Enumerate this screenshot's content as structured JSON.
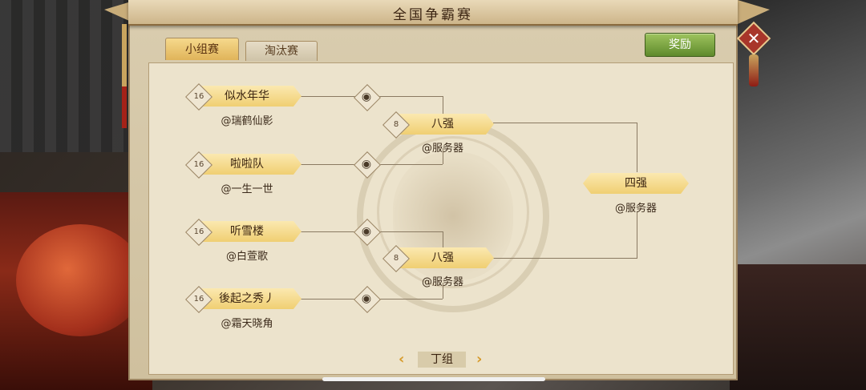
{
  "title": "全国争霸赛",
  "tabs": [
    {
      "label": "小组赛",
      "active": true
    },
    {
      "label": "淘汰赛",
      "active": false
    }
  ],
  "reward_button": "奖励",
  "close_icon": "close-icon",
  "round16": [
    {
      "seed": "16",
      "team": "似水年华",
      "server": "@瑞鹤仙影"
    },
    {
      "seed": "16",
      "team": "啦啦队",
      "server": "@一生一世"
    },
    {
      "seed": "16",
      "team": "听雪楼",
      "server": "@白萱歌"
    },
    {
      "seed": "16",
      "team": "後起之秀丿",
      "server": "@霜天晓角"
    }
  ],
  "round8": [
    {
      "seed": "8",
      "label": "八强",
      "server": "@服务器"
    },
    {
      "seed": "8",
      "label": "八强",
      "server": "@服务器"
    }
  ],
  "round4": {
    "label": "四强",
    "server": "@服务器"
  },
  "watch_icon": "eye-icon",
  "pager": {
    "prev": "‹",
    "group": "丁组",
    "next": "›"
  },
  "colors": {
    "accent": "#f0cf72",
    "reward": "#7da844",
    "close": "#a8362a"
  }
}
